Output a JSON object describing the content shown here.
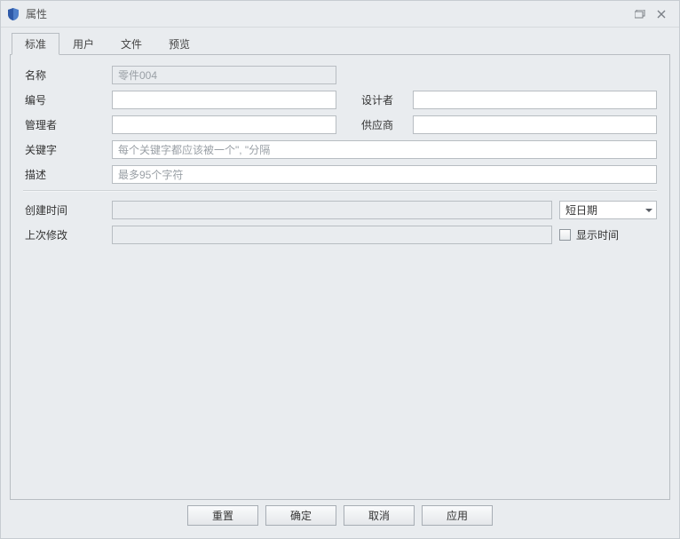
{
  "window": {
    "title": "属性"
  },
  "tabs": {
    "standard": "标准",
    "user": "用户",
    "file": "文件",
    "preview": "预览"
  },
  "labels": {
    "name": "名称",
    "number": "编号",
    "designer": "设计者",
    "manager": "管理者",
    "vendor": "供应商",
    "keywords": "关键字",
    "description": "描述",
    "created": "创建时间",
    "lastModified": "上次修改",
    "showTime": "显示时间"
  },
  "values": {
    "name": "零件004",
    "number": "",
    "designer": "",
    "manager": "",
    "vendor": "",
    "keywords": "",
    "description": "",
    "created": "",
    "lastModified": ""
  },
  "placeholders": {
    "keywords": "每个关键字都应该被一个\", \"分隔",
    "description": "最多95个字符"
  },
  "dateFormat": {
    "selected": "短日期"
  },
  "buttons": {
    "reset": "重置",
    "ok": "确定",
    "cancel": "取消",
    "apply": "应用"
  }
}
